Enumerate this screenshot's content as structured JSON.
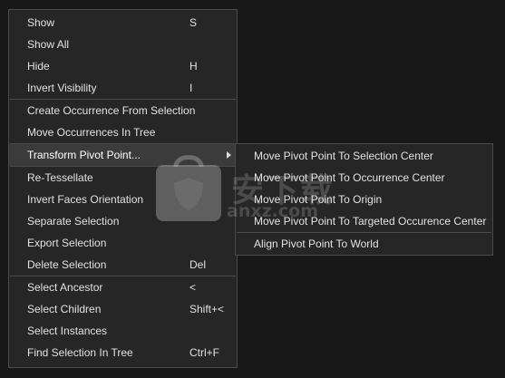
{
  "main_menu": {
    "show": {
      "label": "Show",
      "shortcut": "S"
    },
    "show_all": {
      "label": "Show All"
    },
    "hide": {
      "label": "Hide",
      "shortcut": "H"
    },
    "invert_visibility": {
      "label": "Invert Visibility",
      "shortcut": "I"
    },
    "create_occurrence": {
      "label": "Create Occurrence From Selection"
    },
    "move_occurrences": {
      "label": "Move Occurrences In Tree"
    },
    "transform_pivot": {
      "label": "Transform Pivot Point..."
    },
    "re_tessellate": {
      "label": "Re-Tessellate"
    },
    "invert_faces": {
      "label": "Invert Faces Orientation"
    },
    "separate_selection": {
      "label": "Separate Selection"
    },
    "export_selection": {
      "label": "Export Selection"
    },
    "delete_selection": {
      "label": "Delete Selection",
      "shortcut": "Del"
    },
    "select_ancestor": {
      "label": "Select Ancestor",
      "shortcut": "<"
    },
    "select_children": {
      "label": "Select Children",
      "shortcut": "Shift+<"
    },
    "select_instances": {
      "label": "Select Instances"
    },
    "find_selection": {
      "label": "Find Selection In Tree",
      "shortcut": "Ctrl+F"
    }
  },
  "sub_menu": {
    "selection_center": "Move Pivot Point To Selection Center",
    "occurrence_center": "Move Pivot Point To Occurrence Center",
    "origin": "Move Pivot Point To Origin",
    "targeted_center": "Move Pivot Point To Targeted Occurence Center",
    "align_world": "Align Pivot Point To World"
  },
  "watermark": {
    "text": "安下载",
    "sub": "anxz.com"
  },
  "colors": {
    "menu_bg": "#262626",
    "highlight": "#3b3b3b",
    "border": "#4a4a4a",
    "text": "#e2e2e2"
  }
}
